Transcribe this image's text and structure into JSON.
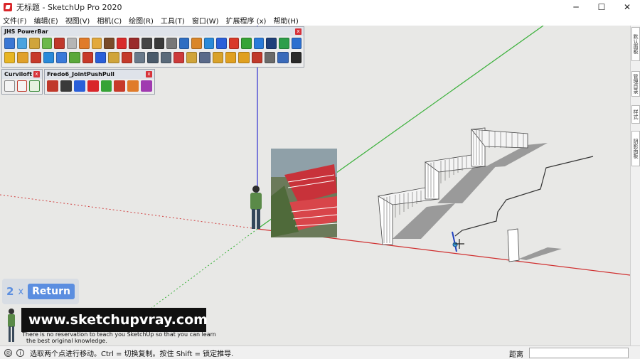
{
  "window": {
    "title": "无标题 - SketchUp Pro 2020",
    "minimize_glyph": "─",
    "maximize_glyph": "☐",
    "close_glyph": "✕"
  },
  "menu": [
    "文件(F)",
    "编辑(E)",
    "视图(V)",
    "相机(C)",
    "绘图(R)",
    "工具(T)",
    "窗口(W)",
    "扩展程序 (x)",
    "帮助(H)"
  ],
  "toolbars": {
    "powerbar": {
      "title": "JHS PowerBar",
      "close": "x",
      "row1_colors": [
        "#3b78d4",
        "#4aa3e0",
        "#d0a43a",
        "#6cb84a",
        "#c0392b",
        "#b5b5b5",
        "#e07b2a",
        "#e2a93c",
        "#7a4b2a",
        "#d92b2b",
        "#9a2b2b",
        "#444444",
        "#3a3a3a",
        "#777777",
        "#2f6ec2",
        "#d9862a",
        "#2a8ad9",
        "#2a5fd9",
        "#d93a2a",
        "#36a336",
        "#2a7ad9",
        "#1f3f7a",
        "#2d9e4b",
        "#2c6fcf"
      ],
      "row2_colors": [
        "#e8b624",
        "#e0a02a",
        "#c73a2a",
        "#2a8ad9",
        "#3a7ad9",
        "#5aa83a",
        "#c73a2a",
        "#2a5fd9",
        "#d0a43a",
        "#c43a2a",
        "#6a7a8a",
        "#4a5a6a",
        "#5a6a7a",
        "#cc3a3a",
        "#d0a43a",
        "#5a6a8a",
        "#d9a22a",
        "#e0a020",
        "#e0a020",
        "#c0392b",
        "#6a6a6a",
        "#3a6aba",
        "#2a2a2a"
      ]
    },
    "curviloft": {
      "title": "Curviloft",
      "close": "x"
    },
    "jpp": {
      "title": "Fredo6_JointPushPull",
      "close": "x"
    }
  },
  "right_tray_tabs": [
    "默认面板",
    "管理目录",
    "样式",
    "阴影面板"
  ],
  "overlay": {
    "repeat_count": "2",
    "times": "x",
    "key": "Return"
  },
  "watermark": {
    "site": "www.sketchupvray.com",
    "line1": "There is no reservation to teach you SketchUp so that you can learn",
    "line2": "the best original knowledge."
  },
  "status": {
    "hint": "选取两个点进行移动。Ctrl = 切换复制。按住 Shift = 锁定推导.",
    "measure_label": "距离",
    "measure_value": ""
  },
  "icons": {
    "status_1": "geo-icon",
    "status_2": "info-icon"
  }
}
